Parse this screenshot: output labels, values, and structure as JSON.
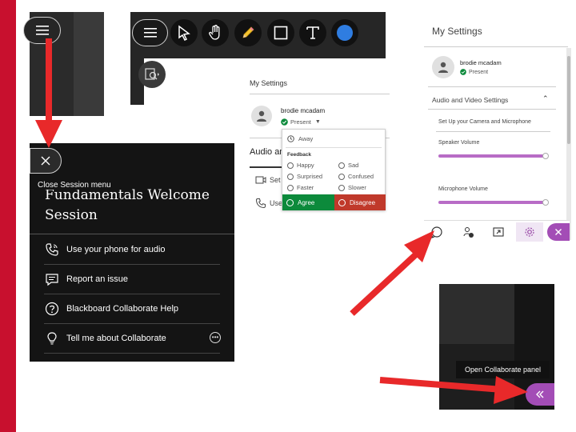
{
  "colors": {
    "accent_red": "#c8102e",
    "purple": "#a34db6",
    "agree_green": "#0c8a3b",
    "disagree_red": "#c0392b"
  },
  "session_menu": {
    "close_tooltip": "Close Session menu",
    "title": "Fundamentals Welcome Session",
    "items": [
      {
        "label": "Use your phone for audio",
        "icon": "phone-icon"
      },
      {
        "label": "Report an issue",
        "icon": "report-icon"
      },
      {
        "label": "Blackboard Collaborate Help",
        "icon": "help-icon"
      },
      {
        "label": "Tell me about Collaborate",
        "icon": "lightbulb-icon"
      }
    ]
  },
  "toolbar": {
    "tools": [
      "menu-icon",
      "select-arrow-icon",
      "pan-hand-icon",
      "pencil-icon",
      "rectangle-icon",
      "text-icon",
      "color-icon"
    ]
  },
  "settings_small": {
    "title": "My Settings",
    "user_name": "brodie mcadam",
    "status": "Present",
    "audio_label": "Audio and",
    "rows": [
      "Set",
      "Use"
    ],
    "dropdown": {
      "away": "Away",
      "feedback_header": "Feedback",
      "left": [
        "Happy",
        "Surprised",
        "Faster"
      ],
      "right": [
        "Sad",
        "Confused",
        "Slower"
      ],
      "agree": "Agree",
      "disagree": "Disagree"
    }
  },
  "settings_large": {
    "title": "My Settings",
    "user_name": "brodie mcadam",
    "status": "Present",
    "section": "Audio and Video Settings",
    "setup_label": "Set Up your Camera and Microphone",
    "speaker_label": "Speaker Volume",
    "mic_label": "Microphone Volume"
  },
  "open_panel": {
    "tooltip": "Open Collaborate panel"
  }
}
